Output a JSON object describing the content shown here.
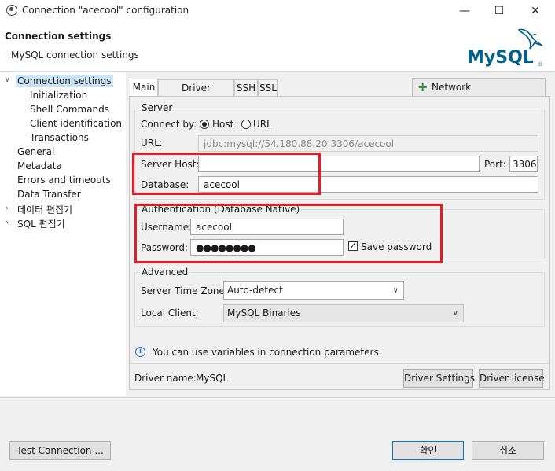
{
  "window": {
    "title": "Connection \"acecool\" configuration",
    "minimize_symbol": "—",
    "maximize_symbol": "☐",
    "close_symbol": "✕"
  },
  "header": {
    "title": "Connection settings",
    "subtitle": "MySQL connection settings",
    "logo_text": "MySQL",
    "logo_color": "#00618a",
    "logo_accent": "#e48e00"
  },
  "tree": {
    "items": [
      {
        "label": "Connection settings",
        "expanded": true,
        "selected": true
      },
      {
        "label": "Initialization"
      },
      {
        "label": "Shell Commands"
      },
      {
        "label": "Client identification"
      },
      {
        "label": "Transactions"
      },
      {
        "label": "General"
      },
      {
        "label": "Metadata"
      },
      {
        "label": "Errors and timeouts"
      },
      {
        "label": "Data Transfer"
      },
      {
        "label": "데이터 편집기",
        "collapsed": true
      },
      {
        "label": "SQL 편집기",
        "collapsed": true
      }
    ]
  },
  "tabs": [
    "Main",
    "Driver properties",
    "SSH",
    "SSL"
  ],
  "network_button": {
    "icon": "plus-icon",
    "label": "Network configurations..."
  },
  "server": {
    "group_title": "Server",
    "connect_by_label": "Connect by:",
    "host_option": "Host",
    "url_option": "URL",
    "url_label": "URL:",
    "url_value": "jdbc:mysql://54.180.88.20:3306/acecool",
    "server_host_label": "Server Host:",
    "server_host_value": "",
    "port_label": "Port:",
    "port_value": "3306",
    "database_label": "Database:",
    "database_value": "acecool"
  },
  "auth": {
    "group_title": "Authentication (Database Native)",
    "username_label": "Username:",
    "username_value": "acecool",
    "password_label": "Password:",
    "password_value": "●●●●●●●●",
    "save_password_label": "Save password",
    "save_password_checked": true
  },
  "advanced": {
    "group_title": "Advanced",
    "timezone_label": "Server Time Zone:",
    "timezone_value": "Auto-detect",
    "local_client_label": "Local Client:",
    "local_client_value": "MySQL Binaries"
  },
  "info": {
    "icon": "info-icon",
    "text": "You can use variables in connection parameters."
  },
  "driver": {
    "name_label": "Driver name:",
    "name_value": "MySQL",
    "settings_button": "Driver Settings",
    "license_button": "Driver license"
  },
  "footer": {
    "test_button": "Test Connection ...",
    "ok_button": "확인",
    "cancel_button": "취소"
  },
  "colors": {
    "highlight_box": "#e01e24",
    "selection": "#cce4f7"
  }
}
